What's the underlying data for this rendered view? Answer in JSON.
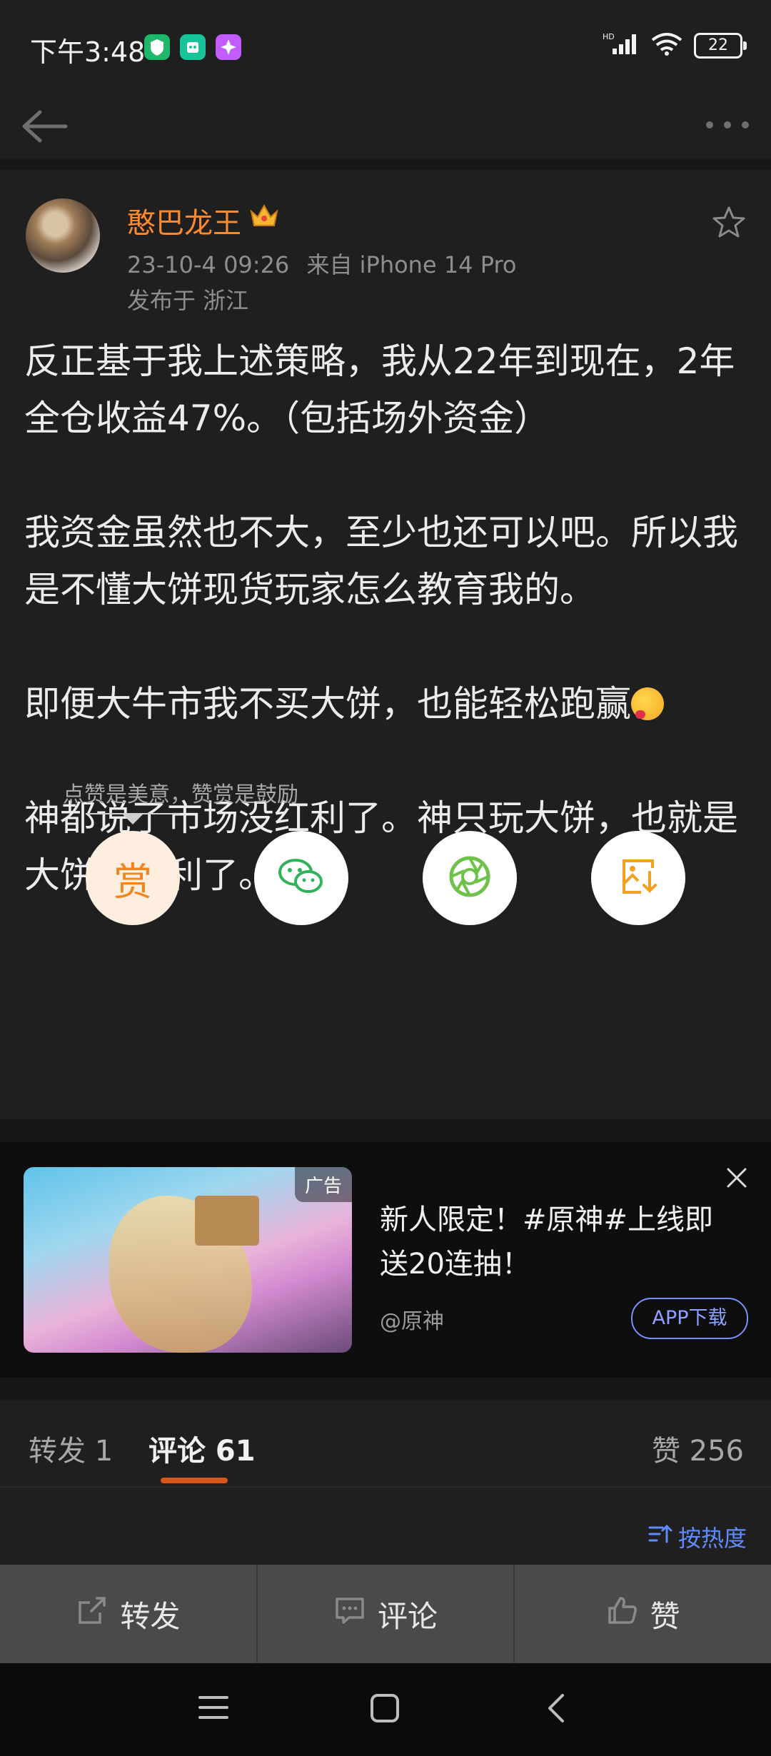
{
  "status_bar": {
    "time": "下午3:48",
    "network_label": "HD",
    "battery": "22",
    "app_icons": [
      {
        "name": "shield-app-icon",
        "color": "#1fb86a"
      },
      {
        "name": "robot-app-icon",
        "color": "#19c39a"
      },
      {
        "name": "spark-app-icon",
        "color": "#c35cff"
      }
    ]
  },
  "nav": {
    "back_icon": "back-arrow-icon",
    "more_icon": "more-dots-icon"
  },
  "post": {
    "author": "憨巴龙王",
    "badge_icon": "crown-badge-icon",
    "timestamp": "23-10-4 09:26",
    "source": "来自 iPhone 14 Pro",
    "location": "发布于 浙江",
    "paragraphs": [
      "反正基于我上述策略，我从22年到现在，2年全仓收益47%。（包括场外资金）",
      "我资金虽然也不大，至少也还可以吧。所以我是不懂大饼现货玩家怎么教育我的。",
      "即便大牛市我不买大饼，也能轻松跑赢",
      "神都说了市场没红利了。神只玩大饼，也就是大饼没红利了。"
    ]
  },
  "reward": {
    "tip": "点赞是美意，赞赏是鼓励",
    "reward_label": "赏"
  },
  "ad": {
    "badge": "广告",
    "title": "新人限定！#原神#上线即送20连抽！",
    "source": "@原神",
    "button": "APP下载"
  },
  "tabs": {
    "repost": "转发 1",
    "comments": "评论 61",
    "likes": "赞 256"
  },
  "sort_label": "按热度",
  "action_bar": {
    "repost": "转发",
    "comment": "评论",
    "like": "赞"
  },
  "colors": {
    "accent_orange": "#ff8a2b",
    "link_blue": "#5e8bff",
    "tab_indicator": "#d8581c"
  }
}
